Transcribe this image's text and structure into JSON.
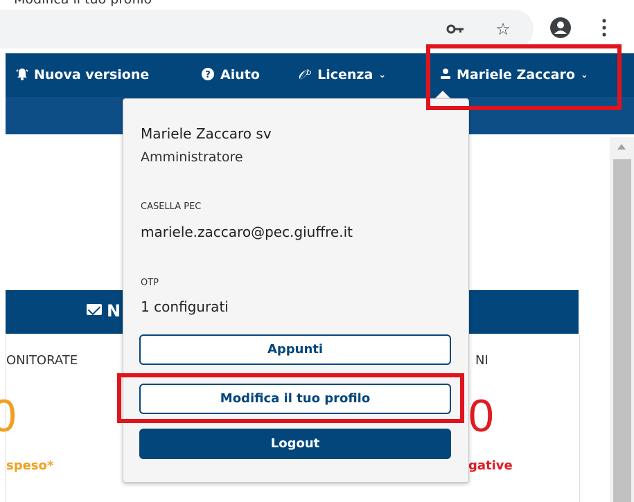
{
  "caption": {
    "text": "Modifica il tuo profilo"
  },
  "browser": {
    "icons": [
      "key-icon",
      "star-icon",
      "account-icon",
      "menu-dots-icon"
    ]
  },
  "navbar": {
    "new_version": "Nuova versione",
    "help": "Aiuto",
    "license": "Licenza",
    "user": "Mariele Zaccaro"
  },
  "background_card": {
    "header_fragment": "N",
    "left_label": "ONITORATE",
    "right_label": "NI",
    "left_number": "0",
    "right_number": "0",
    "left_caption": "speso*",
    "right_caption": "gative",
    "colors": {
      "left": "#f0a020",
      "right": "#e11b22"
    }
  },
  "dropdown": {
    "name": "Mariele Zaccaro sv",
    "role": "Amministratore",
    "pec_label": "CASELLA PEC",
    "pec_value": "mariele.zaccaro@pec.giuffre.it",
    "otp_label": "OTP",
    "otp_value": "1 configurati",
    "buttons": {
      "notes": "Appunti",
      "edit_profile": "Modifica il tuo profilo",
      "logout": "Logout"
    }
  },
  "colors": {
    "primary": "#03467c",
    "highlight": "#e0141d"
  }
}
